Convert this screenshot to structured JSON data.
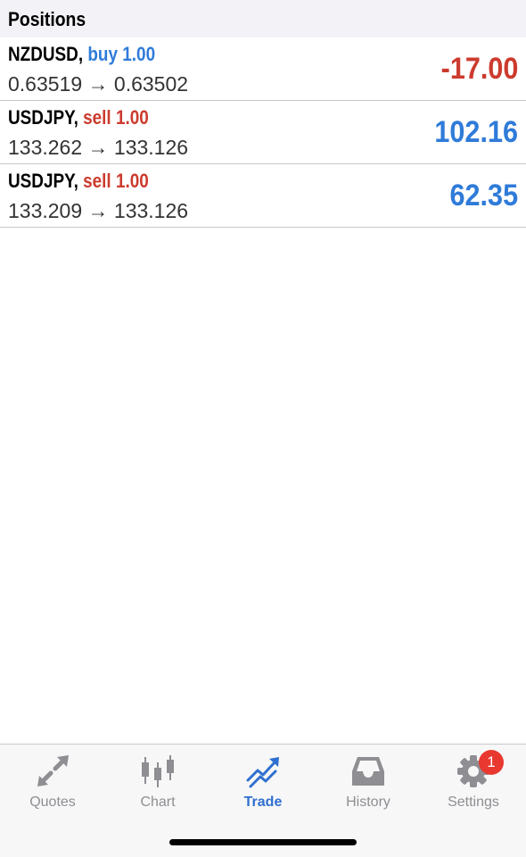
{
  "header": {
    "title": "Positions"
  },
  "positions": [
    {
      "symbol": "NZDUSD",
      "side": "buy",
      "volume": "1.00",
      "open_price": "0.63519",
      "current_price": "0.63502",
      "profit": "-17.00"
    },
    {
      "symbol": "USDJPY",
      "side": "sell",
      "volume": "1.00",
      "open_price": "133.262",
      "current_price": "133.126",
      "profit": "102.16"
    },
    {
      "symbol": "USDJPY",
      "side": "sell",
      "volume": "1.00",
      "open_price": "133.209",
      "current_price": "133.126",
      "profit": "62.35"
    }
  ],
  "tabbar": {
    "tabs": [
      {
        "label": "Quotes",
        "icon": "quotes-arrows-icon"
      },
      {
        "label": "Chart",
        "icon": "candlestick-icon"
      },
      {
        "label": "Trade",
        "icon": "trade-trend-icon",
        "active": true
      },
      {
        "label": "History",
        "icon": "inbox-tray-icon"
      },
      {
        "label": "Settings",
        "icon": "gear-icon",
        "badge": "1"
      }
    ]
  },
  "colors": {
    "buy": "#2f7bd9",
    "sell": "#cc3b2e",
    "active_tab": "#2f6fd0",
    "inactive_tab": "#8e8e93",
    "badge": "#e8382f"
  }
}
